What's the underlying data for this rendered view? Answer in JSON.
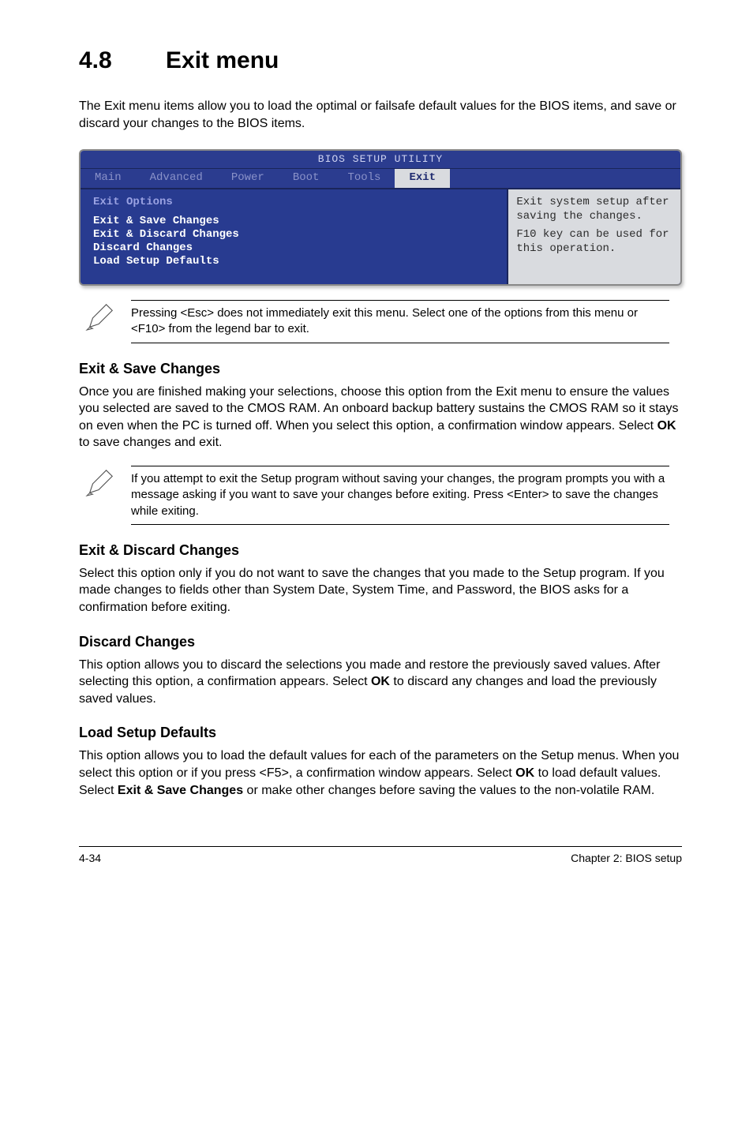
{
  "header": {
    "number": "4.8",
    "title": "Exit menu"
  },
  "intro": "The Exit menu items allow you to load the optimal or failsafe default values for the BIOS items, and save or discard your changes to the BIOS items.",
  "bios": {
    "titlebar": "BIOS SETUP UTILITY",
    "tabs": [
      "Main",
      "Advanced",
      "Power",
      "Boot",
      "Tools",
      "Exit"
    ],
    "active_tab_index": 5,
    "left": {
      "heading": "Exit Options",
      "items": [
        "Exit & Save Changes",
        "Exit & Discard Changes",
        "Discard Changes",
        "",
        "Load Setup Defaults"
      ]
    },
    "right": {
      "line1": "Exit system setup after saving the changes.",
      "line2": "F10 key can be used for this operation."
    }
  },
  "note1": "Pressing <Esc> does not immediately exit this menu. Select one of the options from this menu or <F10> from the legend bar to exit.",
  "sections": {
    "exit_save": {
      "title": "Exit & Save Changes",
      "p_a": "Once you are finished making your selections, choose this option from the Exit menu to ensure the values you selected are saved to the CMOS RAM. An onboard backup battery sustains the CMOS RAM so it stays on even when the PC is turned off. When you select this option, a confirmation window appears. Select ",
      "ok": "OK",
      "p_b": " to save changes and exit."
    },
    "note2": " If you attempt to exit the Setup program without saving your changes, the program prompts you with a message asking if you want to save your changes before exiting. Press <Enter>  to save the  changes while exiting.",
    "exit_discard": {
      "title": "Exit & Discard Changes",
      "p": "Select this option only if you do not want to save the changes that you  made to the Setup program. If you made changes to fields other than System Date, System Time, and Password, the BIOS asks for a confirmation before exiting."
    },
    "discard": {
      "title": "Discard Changes",
      "p_a": "This option allows you to discard the selections you made and restore the previously saved values. After selecting this option, a confirmation appears. Select ",
      "ok": "OK",
      "p_b": " to discard any changes and load the previously saved values."
    },
    "load_def": {
      "title": "Load Setup Defaults",
      "p_a": "This option allows you to load the default values for each of the parameters on the Setup menus. When you select this option or if you press <F5>, a confirmation window appears. Select ",
      "ok": "OK",
      "p_b": " to load default values. Select ",
      "exitsave": "Exit & Save Changes",
      "p_c": " or make other changes before saving the values to the non-volatile RAM."
    }
  },
  "footer": {
    "left": "4-34",
    "right": "Chapter 2: BIOS setup"
  }
}
